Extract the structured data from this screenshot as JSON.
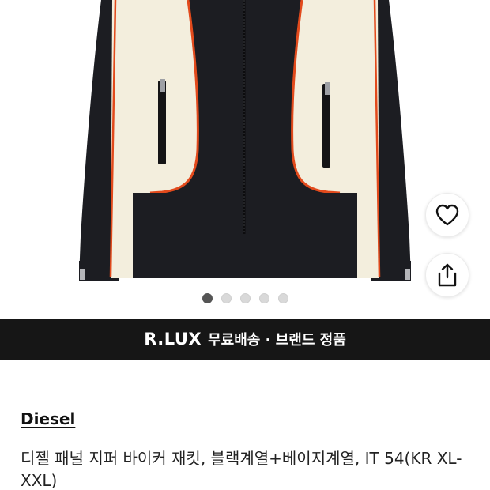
{
  "gallery": {
    "image_alt_name": "jacket-photo",
    "dots_total": 5,
    "dots_active_index": 0,
    "wishlist_icon": "heart-icon",
    "share_icon": "share-icon"
  },
  "banner": {
    "brand": "R.LUX",
    "text": "무료배송 · 브랜드 정품"
  },
  "product": {
    "brand": "Diesel",
    "title": "디젤 패널 지퍼 바이커 재킷, 블랙계열+베이지계열, IT 54(KR XL-XXL)"
  },
  "colors": {
    "banner_bg": "#161616",
    "dot_active": "#555555",
    "dot_inactive": "#d9d9d9",
    "jacket_black": "#1c1d22",
    "jacket_beige": "#f3eedd",
    "piping_orange": "#e24a1c"
  }
}
